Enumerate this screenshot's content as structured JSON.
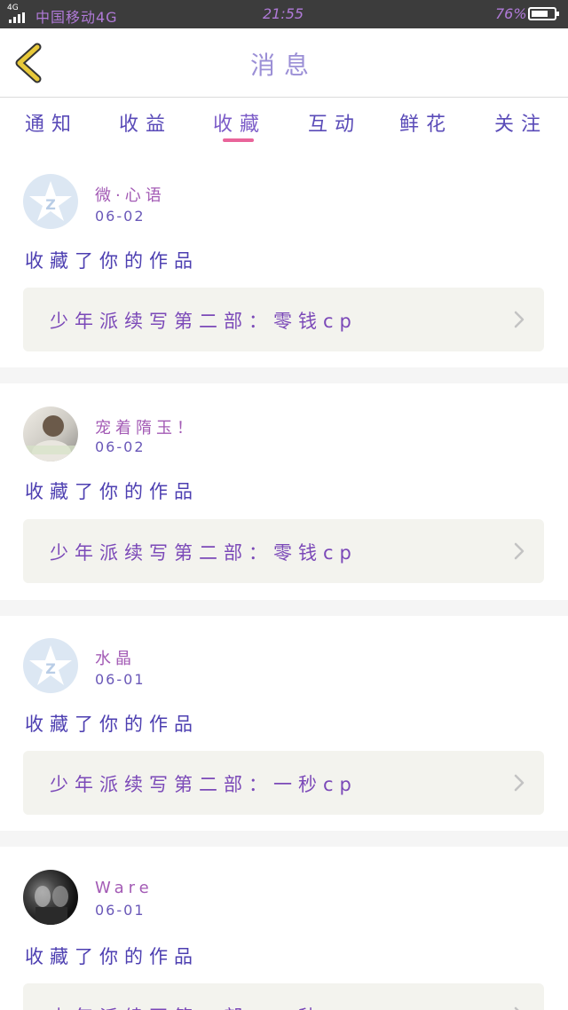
{
  "status_bar": {
    "network": "4G",
    "carrier": "中国移动4G",
    "time": "21:55",
    "battery": "76%",
    "battery_level": 0.76
  },
  "header": {
    "title": "消息",
    "back_icon": "chevron-left-icon"
  },
  "tabs": [
    {
      "label": "通知",
      "active": false
    },
    {
      "label": "收益",
      "active": false
    },
    {
      "label": "收藏",
      "active": true
    },
    {
      "label": "互动",
      "active": false
    },
    {
      "label": "鲜花",
      "active": false
    },
    {
      "label": "关注",
      "active": false
    }
  ],
  "messages": [
    {
      "user": "微·心语",
      "date": "06-02",
      "action": "收藏了你的作品",
      "work": "少年派续写第二部：零钱cp",
      "avatar": "default-star-icon"
    },
    {
      "user": "宠着隋玉！",
      "date": "06-02",
      "action": "收藏了你的作品",
      "work": "少年派续写第二部：零钱cp",
      "avatar": "user-photo"
    },
    {
      "user": "水晶",
      "date": "06-01",
      "action": "收藏了你的作品",
      "work": "少年派续写第二部：一秒cp",
      "avatar": "default-star-icon"
    },
    {
      "user": "Ware",
      "date": "06-01",
      "action": "收藏了你的作品",
      "work": "少年派续写第二部：一秒cp",
      "avatar": "user-photo"
    }
  ],
  "colors": {
    "tab_underline": "#e9649a",
    "back_arrow": "#e8c93a",
    "separator": "#f5f5f5",
    "card_bg": "#f3f3ee"
  }
}
